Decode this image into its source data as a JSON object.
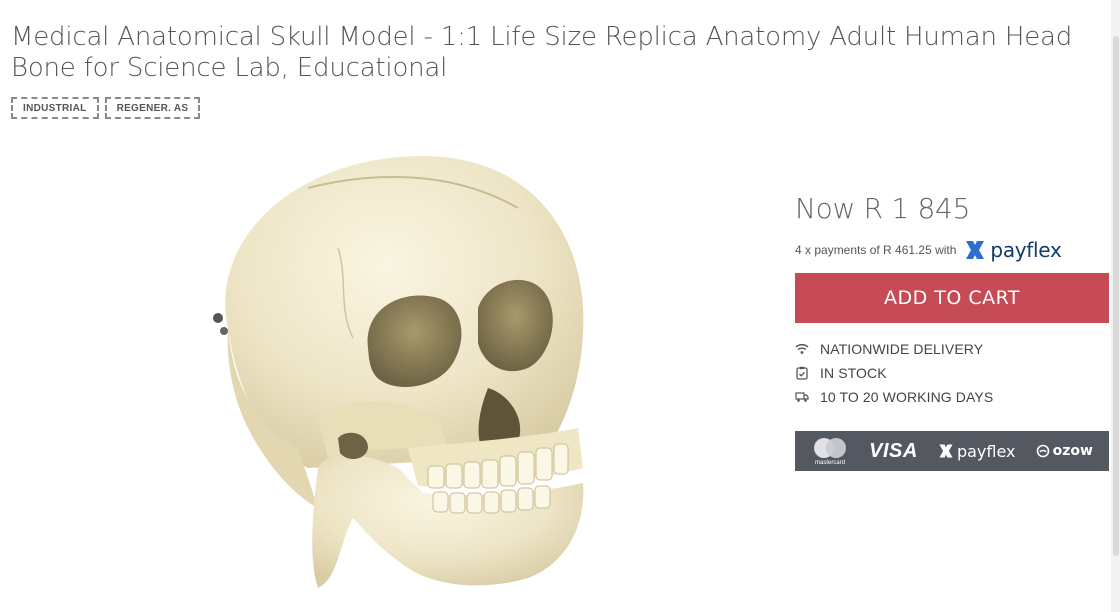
{
  "product": {
    "title": "Medical Anatomical Skull Model - 1:1 Life Size Replica Anatomy Adult Human Head Bone for Science Lab, Educational",
    "tags": [
      "INDUSTRIAL",
      "REGENER. AS"
    ],
    "image_icon": "skull-product-image"
  },
  "buy_box": {
    "price": "Now R 1 845",
    "installments_text": "4 x payments of R 461.25 with",
    "installments_brand": "payflex",
    "add_to_cart_label": "ADD TO CART",
    "features": [
      {
        "icon": "wifi-icon",
        "label": "NATIONWIDE DELIVERY"
      },
      {
        "icon": "clipboard-check-icon",
        "label": "IN STOCK"
      },
      {
        "icon": "truck-icon",
        "label": "10 TO 20 WORKING DAYS"
      }
    ]
  },
  "payment_methods": {
    "mastercard_label": "mastercard",
    "visa_label": "VISA",
    "payflex_label": "payflex",
    "ozow_label": "ozow"
  },
  "colors": {
    "add_to_cart": "#c64b55",
    "payment_bar": "#535861",
    "payflex_brand": "#123a6e"
  }
}
